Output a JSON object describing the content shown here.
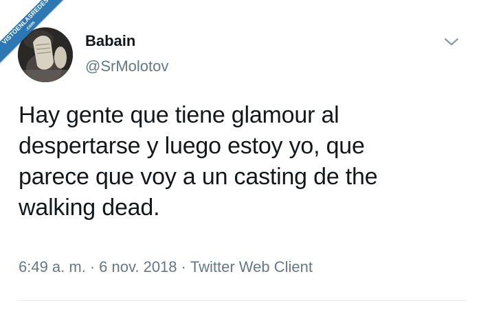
{
  "watermark": {
    "line1": "VISTOENLASREDES",
    "line2": ".com"
  },
  "author": {
    "display_name": "Babain",
    "handle": "@SrMolotov"
  },
  "tweet": {
    "lines": [
      "Hay gente que tiene glamour al",
      "despertarse y luego estoy yo, que",
      "parece que voy a un casting de the",
      "walking dead."
    ]
  },
  "meta": {
    "time": "6:49 a. m.",
    "separator": "·",
    "date": "6 nov. 2018",
    "client": "Twitter Web Client"
  },
  "colors": {
    "text": "#14171a",
    "secondary": "#657786",
    "watermark": "#2b78b4"
  },
  "icons": {
    "menu": "chevron-down-icon"
  }
}
